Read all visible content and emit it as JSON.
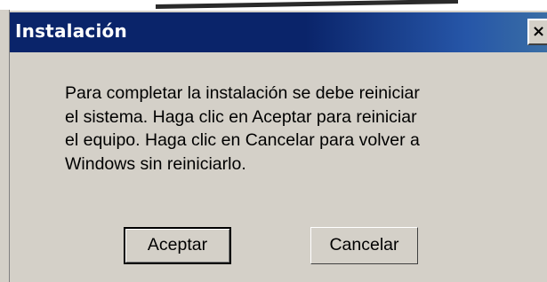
{
  "window": {
    "title": "Instalación",
    "close_glyph": "×"
  },
  "message": {
    "lines": [
      "Para completar la instalación se debe reiniciar",
      "el sistema. Haga clic en Aceptar para reiniciar",
      "el equipo. Haga clic en Cancelar para volver a",
      "Windows sin reiniciarlo."
    ]
  },
  "buttons": {
    "accept_label": "Aceptar",
    "cancel_label": "Cancelar"
  },
  "colors": {
    "titlebar": "#0a246a",
    "dialog_face": "#d4d0c8",
    "title_text": "#ffffff"
  },
  "icons": {
    "close": "close-icon"
  }
}
